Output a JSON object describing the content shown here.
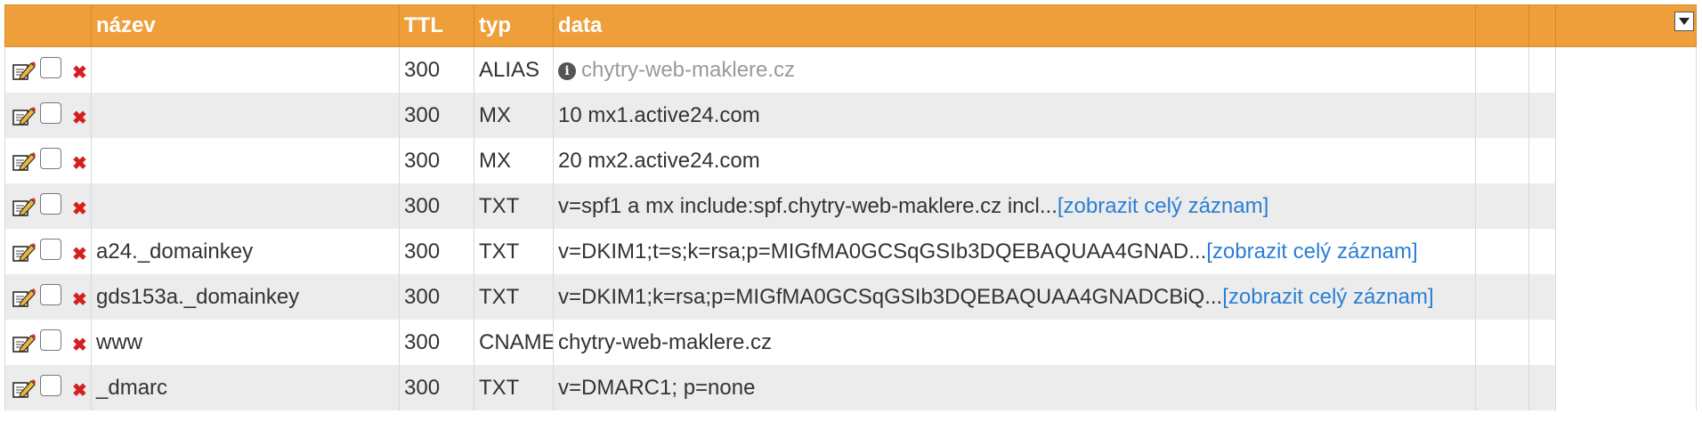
{
  "header": {
    "col_name": "název",
    "col_ttl": "TTL",
    "col_type": "typ",
    "col_data": "data"
  },
  "colors": {
    "header_bg": "#ef9f3a",
    "link": "#2a7fd4",
    "delete": "#d62020"
  },
  "icons": {
    "edit": "edit-pencil-icon",
    "delete": "delete-x-icon",
    "info": "info-icon",
    "dropdown": "chevron-down-icon"
  },
  "rows": [
    {
      "name": "",
      "ttl": "300",
      "type": "ALIAS",
      "data": "chytry-web-maklere.cz",
      "link": "",
      "info": true
    },
    {
      "name": "",
      "ttl": "300",
      "type": "MX",
      "data": "10 mx1.active24.com",
      "link": ""
    },
    {
      "name": "",
      "ttl": "300",
      "type": "MX",
      "data": "20 mx2.active24.com",
      "link": ""
    },
    {
      "name": "",
      "ttl": "300",
      "type": "TXT",
      "data": "v=spf1 a mx include:spf.chytry-web-maklere.cz incl...",
      "link": "[zobrazit celý záznam]"
    },
    {
      "name": "a24._domainkey",
      "ttl": "300",
      "type": "TXT",
      "data": "v=DKIM1;t=s;k=rsa;p=MIGfMA0GCSqGSIb3DQEBAQUAA4GNAD...",
      "link": "[zobrazit celý záznam]"
    },
    {
      "name": "gds153a._domainkey",
      "ttl": "300",
      "type": "TXT",
      "data": "v=DKIM1;k=rsa;p=MIGfMA0GCSqGSIb3DQEBAQUAA4GNADCBiQ...",
      "link": "[zobrazit celý záznam]"
    },
    {
      "name": "www",
      "ttl": "300",
      "type": "CNAME",
      "data": "chytry-web-maklere.cz",
      "link": ""
    },
    {
      "name": "_dmarc",
      "ttl": "300",
      "type": "TXT",
      "data": "v=DMARC1; p=none",
      "link": ""
    }
  ]
}
